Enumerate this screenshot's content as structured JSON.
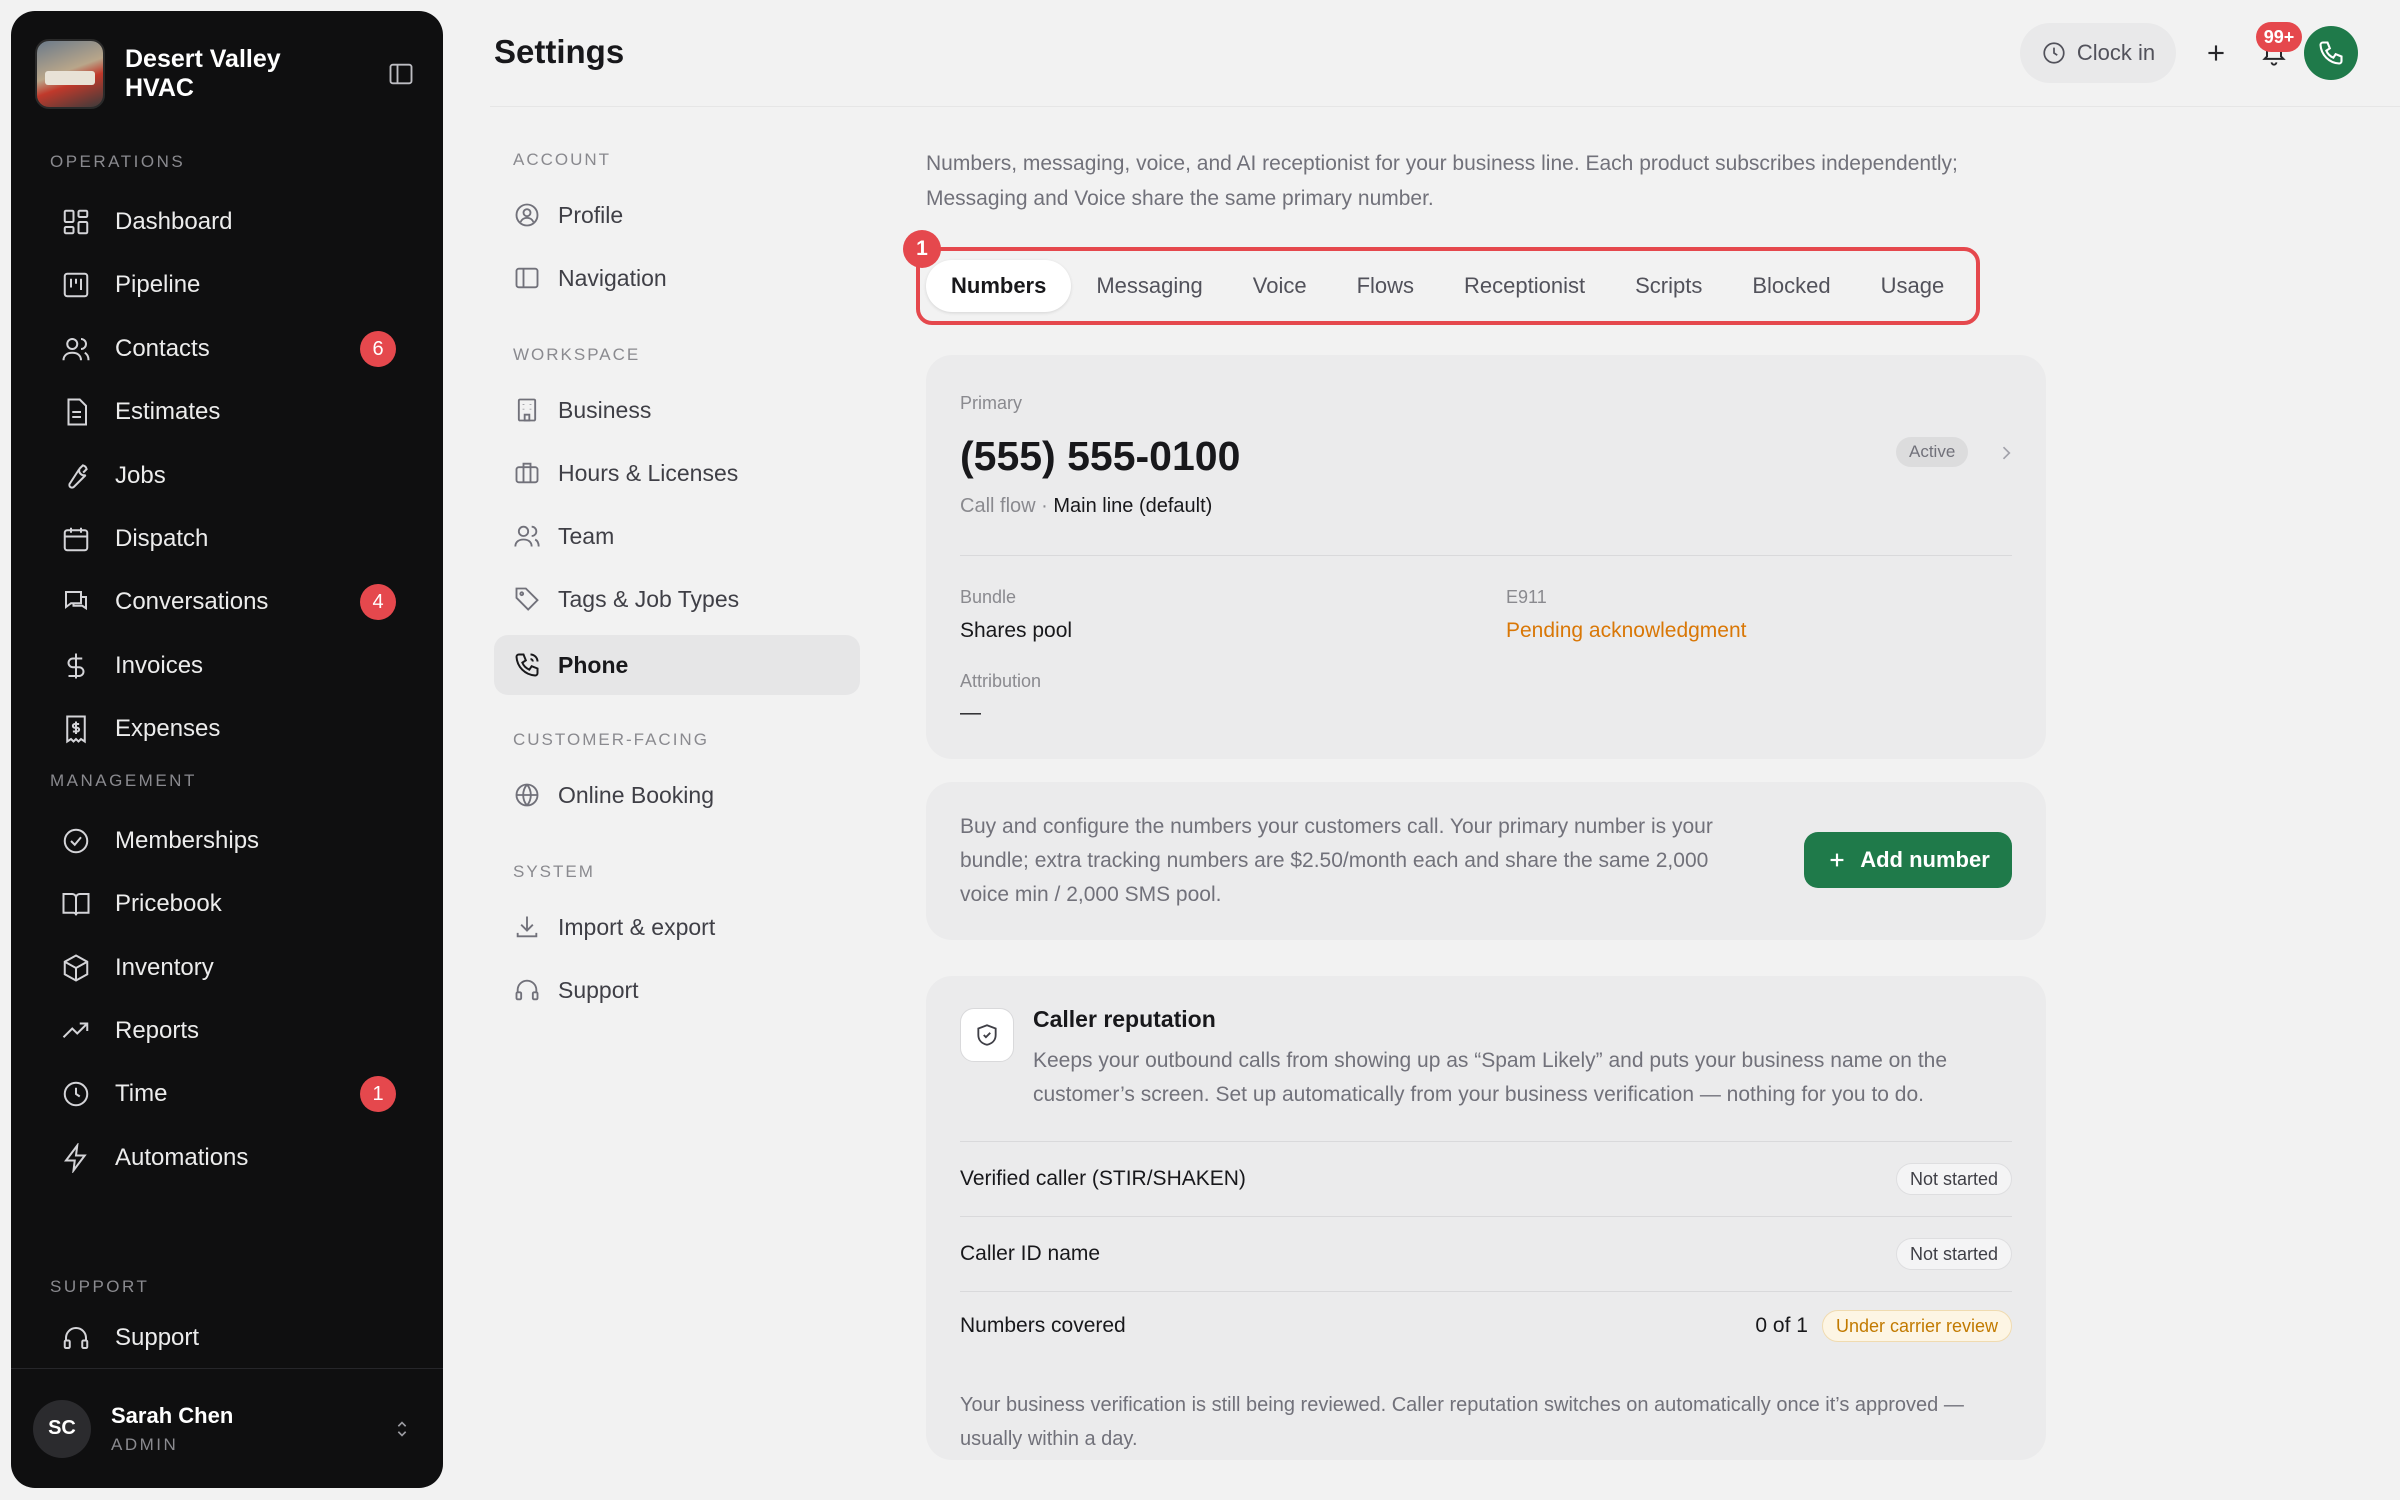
{
  "brand": {
    "name": "Desert Valley HVAC"
  },
  "sidebar": {
    "sections": [
      "OPERATIONS",
      "MANAGEMENT",
      "SUPPORT"
    ],
    "items": [
      {
        "label": "Dashboard",
        "icon": "dashboard-icon"
      },
      {
        "label": "Pipeline",
        "icon": "pipeline-icon"
      },
      {
        "label": "Contacts",
        "icon": "contacts-icon",
        "badge": "6"
      },
      {
        "label": "Estimates",
        "icon": "estimates-icon"
      },
      {
        "label": "Jobs",
        "icon": "wrench-icon"
      },
      {
        "label": "Dispatch",
        "icon": "calendar-icon"
      },
      {
        "label": "Conversations",
        "icon": "chat-icon",
        "badge": "4"
      },
      {
        "label": "Invoices",
        "icon": "dollar-icon"
      },
      {
        "label": "Expenses",
        "icon": "receipt-icon"
      },
      {
        "label": "Memberships",
        "icon": "badge-check-icon"
      },
      {
        "label": "Pricebook",
        "icon": "book-icon"
      },
      {
        "label": "Inventory",
        "icon": "box-icon"
      },
      {
        "label": "Reports",
        "icon": "trend-icon"
      },
      {
        "label": "Time",
        "icon": "clock-icon",
        "badge": "1"
      },
      {
        "label": "Automations",
        "icon": "bolt-icon"
      },
      {
        "label": "Support",
        "icon": "headset-icon"
      }
    ],
    "user": {
      "initials": "SC",
      "name": "Sarah Chen",
      "role": "ADMIN"
    }
  },
  "header": {
    "title": "Settings",
    "clock_in": "Clock in",
    "notifications": "99+"
  },
  "settings_nav": {
    "sections": [
      "ACCOUNT",
      "WORKSPACE",
      "CUSTOMER-FACING",
      "SYSTEM"
    ],
    "items": [
      {
        "label": "Profile",
        "icon": "user-circle-icon"
      },
      {
        "label": "Navigation",
        "icon": "sidebar-icon"
      },
      {
        "label": "Business",
        "icon": "building-icon"
      },
      {
        "label": "Hours & Licenses",
        "icon": "briefcase-icon"
      },
      {
        "label": "Team",
        "icon": "team-icon"
      },
      {
        "label": "Tags & Job Types",
        "icon": "tag-icon"
      },
      {
        "label": "Phone",
        "icon": "phone-icon",
        "active": true
      },
      {
        "label": "Online Booking",
        "icon": "globe-icon"
      },
      {
        "label": "Import & export",
        "icon": "download-icon"
      },
      {
        "label": "Support",
        "icon": "headset-icon"
      }
    ]
  },
  "phone": {
    "intro": "Numbers, messaging, voice, and AI receptionist for your business line. Each product subscribes independently; Messaging and Voice share the same primary number.",
    "callout": "1",
    "tabs": [
      "Numbers",
      "Messaging",
      "Voice",
      "Flows",
      "Receptionist",
      "Scripts",
      "Blocked",
      "Usage"
    ],
    "active_tab": "Numbers",
    "primary": {
      "label": "Primary",
      "number": "(555) 555-0100",
      "status": "Active",
      "call_flow_label": "Call flow · ",
      "call_flow_value": "Main line (default)",
      "bundle_label": "Bundle",
      "bundle_value": "Shares pool",
      "e911_label": "E911",
      "e911_value": "Pending acknowledgment",
      "attribution_label": "Attribution",
      "attribution_value": "—"
    },
    "add_card": {
      "text": "Buy and configure the numbers your customers call. Your primary number is your bundle; extra tracking numbers are $2.50/month each and share the same 2,000 voice min / 2,000 SMS pool.",
      "button": "Add number"
    },
    "reputation": {
      "title": "Caller reputation",
      "description": "Keeps your outbound calls from showing up as “Spam Likely” and puts your business name on the customer’s screen. Set up automatically from your business verification — nothing for you to do.",
      "rows": [
        {
          "label": "Verified caller (STIR/SHAKEN)",
          "status": "Not started"
        },
        {
          "label": "Caller ID name",
          "status": "Not started"
        },
        {
          "label": "Numbers covered",
          "value": "0 of 1",
          "status": "Under carrier review"
        }
      ],
      "footer": "Your business verification is still being reviewed. Caller reputation switches on automatically once it’s approved — usually within a day."
    }
  },
  "colors": {
    "accent_green": "#1f7a4a",
    "badge_red": "#e5484d",
    "warning_orange": "#d97706"
  }
}
